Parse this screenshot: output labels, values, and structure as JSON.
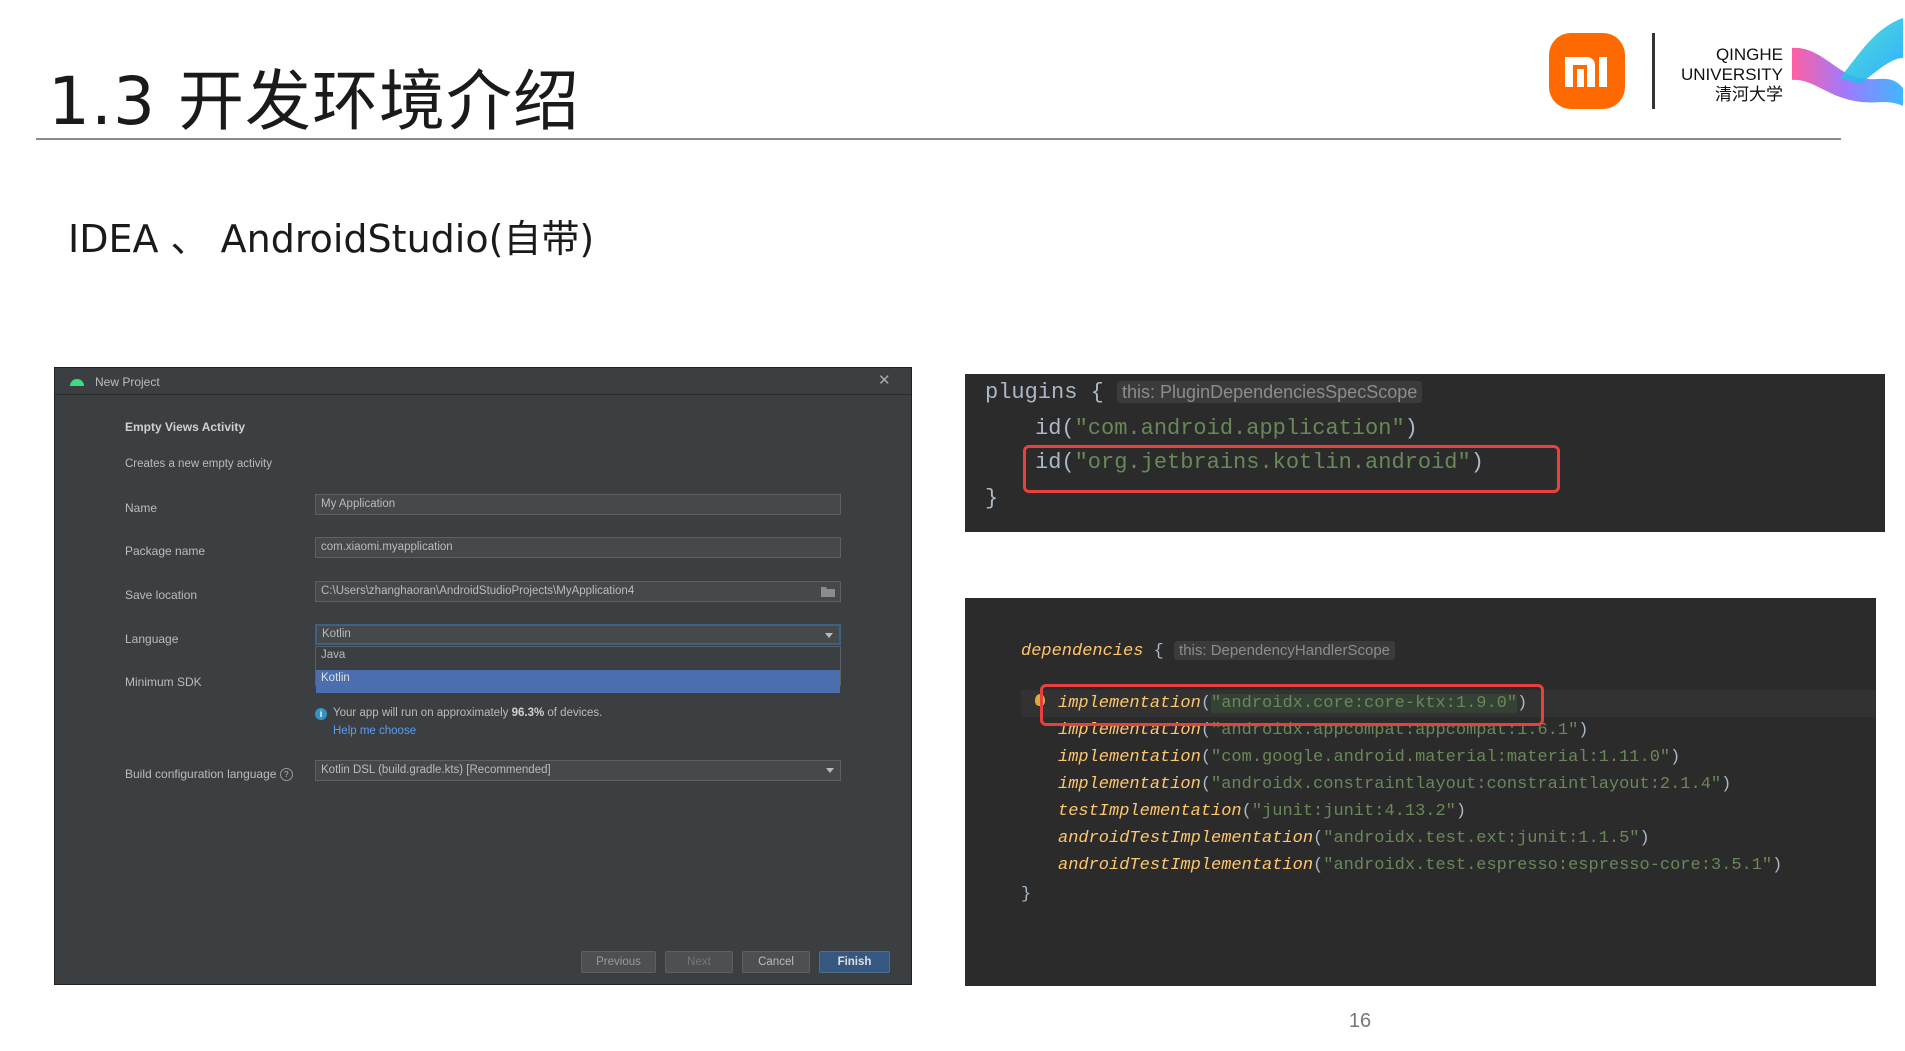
{
  "slide": {
    "title": "1.3 开发环境介绍",
    "subtitle": "IDEA 、 AndroidStudio(自带)",
    "page_number": "16",
    "logo": {
      "university_lines": [
        "QINGHE",
        "UNIVERSITY",
        "清河大学"
      ]
    },
    "colors": {
      "mi_orange": "#ff6a00",
      "highlight_red": "#e8403d"
    }
  },
  "dialog": {
    "title": "New Project",
    "heading": "Empty Views Activity",
    "description": "Creates a new empty activity",
    "fields": {
      "name_label": "Name",
      "name_value": "My Application",
      "package_label": "Package name",
      "package_value": "com.xiaomi.myapplication",
      "save_label": "Save location",
      "save_value": "C:\\Users\\zhanghaoran\\AndroidStudioProjects\\MyApplication4",
      "language_label": "Language",
      "language_value": "Kotlin",
      "language_options": [
        "Java",
        "Kotlin"
      ],
      "min_sdk_label": "Minimum SDK",
      "info_prefix": "Your app will run on approximately ",
      "info_percent": "96.3%",
      "info_suffix": " of devices.",
      "help_link": "Help me choose",
      "build_label": "Build configuration language",
      "build_value": "Kotlin DSL (build.gradle.kts) [Recommended]"
    },
    "buttons": {
      "previous": "Previous",
      "next": "Next",
      "cancel": "Cancel",
      "finish": "Finish"
    }
  },
  "code_plugins": {
    "header": "plugins",
    "hint": "this: PluginDependenciesSpecScope",
    "lines": [
      {
        "fn": "id",
        "arg": "\"com.android.application\""
      },
      {
        "fn": "id",
        "arg": "\"org.jetbrains.kotlin.android\""
      }
    ],
    "close": "}"
  },
  "code_deps": {
    "header": "dependencies",
    "hint": "this: DependencyHandlerScope",
    "lines": [
      {
        "fn": "implementation",
        "arg": "\"androidx.core:core-ktx:1.9.0\""
      },
      {
        "fn": "implementation",
        "arg": "\"androidx.appcompat:appcompat:1.6.1\""
      },
      {
        "fn": "implementation",
        "arg": "\"com.google.android.material:material:1.11.0\""
      },
      {
        "fn": "implementation",
        "arg": "\"androidx.constraintlayout:constraintlayout:2.1.4\""
      },
      {
        "fn": "testImplementation",
        "arg": "\"junit:junit:4.13.2\""
      },
      {
        "fn": "androidTestImplementation",
        "arg": "\"androidx.test.ext:junit:1.1.5\""
      },
      {
        "fn": "androidTestImplementation",
        "arg": "\"androidx.test.espresso:espresso-core:3.5.1\""
      }
    ],
    "close": "}"
  }
}
